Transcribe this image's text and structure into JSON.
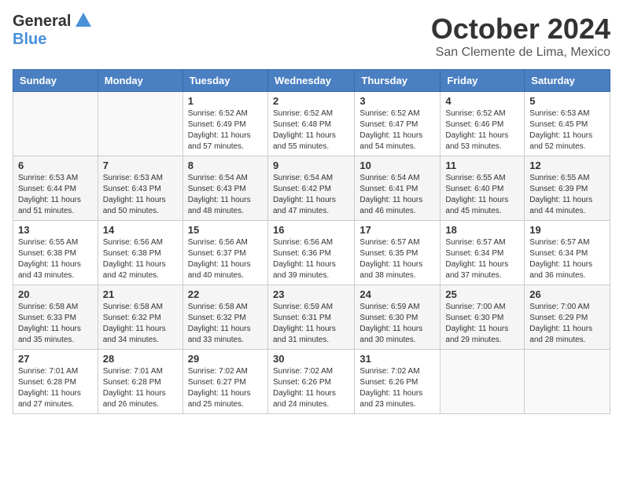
{
  "header": {
    "logo": {
      "general": "General",
      "blue": "Blue"
    },
    "month": "October 2024",
    "location": "San Clemente de Lima, Mexico"
  },
  "columns": [
    "Sunday",
    "Monday",
    "Tuesday",
    "Wednesday",
    "Thursday",
    "Friday",
    "Saturday"
  ],
  "weeks": [
    [
      {
        "day": "",
        "sunrise": "",
        "sunset": "",
        "daylight": ""
      },
      {
        "day": "",
        "sunrise": "",
        "sunset": "",
        "daylight": ""
      },
      {
        "day": "1",
        "sunrise": "Sunrise: 6:52 AM",
        "sunset": "Sunset: 6:49 PM",
        "daylight": "Daylight: 11 hours and 57 minutes."
      },
      {
        "day": "2",
        "sunrise": "Sunrise: 6:52 AM",
        "sunset": "Sunset: 6:48 PM",
        "daylight": "Daylight: 11 hours and 55 minutes."
      },
      {
        "day": "3",
        "sunrise": "Sunrise: 6:52 AM",
        "sunset": "Sunset: 6:47 PM",
        "daylight": "Daylight: 11 hours and 54 minutes."
      },
      {
        "day": "4",
        "sunrise": "Sunrise: 6:52 AM",
        "sunset": "Sunset: 6:46 PM",
        "daylight": "Daylight: 11 hours and 53 minutes."
      },
      {
        "day": "5",
        "sunrise": "Sunrise: 6:53 AM",
        "sunset": "Sunset: 6:45 PM",
        "daylight": "Daylight: 11 hours and 52 minutes."
      }
    ],
    [
      {
        "day": "6",
        "sunrise": "Sunrise: 6:53 AM",
        "sunset": "Sunset: 6:44 PM",
        "daylight": "Daylight: 11 hours and 51 minutes."
      },
      {
        "day": "7",
        "sunrise": "Sunrise: 6:53 AM",
        "sunset": "Sunset: 6:43 PM",
        "daylight": "Daylight: 11 hours and 50 minutes."
      },
      {
        "day": "8",
        "sunrise": "Sunrise: 6:54 AM",
        "sunset": "Sunset: 6:43 PM",
        "daylight": "Daylight: 11 hours and 48 minutes."
      },
      {
        "day": "9",
        "sunrise": "Sunrise: 6:54 AM",
        "sunset": "Sunset: 6:42 PM",
        "daylight": "Daylight: 11 hours and 47 minutes."
      },
      {
        "day": "10",
        "sunrise": "Sunrise: 6:54 AM",
        "sunset": "Sunset: 6:41 PM",
        "daylight": "Daylight: 11 hours and 46 minutes."
      },
      {
        "day": "11",
        "sunrise": "Sunrise: 6:55 AM",
        "sunset": "Sunset: 6:40 PM",
        "daylight": "Daylight: 11 hours and 45 minutes."
      },
      {
        "day": "12",
        "sunrise": "Sunrise: 6:55 AM",
        "sunset": "Sunset: 6:39 PM",
        "daylight": "Daylight: 11 hours and 44 minutes."
      }
    ],
    [
      {
        "day": "13",
        "sunrise": "Sunrise: 6:55 AM",
        "sunset": "Sunset: 6:38 PM",
        "daylight": "Daylight: 11 hours and 43 minutes."
      },
      {
        "day": "14",
        "sunrise": "Sunrise: 6:56 AM",
        "sunset": "Sunset: 6:38 PM",
        "daylight": "Daylight: 11 hours and 42 minutes."
      },
      {
        "day": "15",
        "sunrise": "Sunrise: 6:56 AM",
        "sunset": "Sunset: 6:37 PM",
        "daylight": "Daylight: 11 hours and 40 minutes."
      },
      {
        "day": "16",
        "sunrise": "Sunrise: 6:56 AM",
        "sunset": "Sunset: 6:36 PM",
        "daylight": "Daylight: 11 hours and 39 minutes."
      },
      {
        "day": "17",
        "sunrise": "Sunrise: 6:57 AM",
        "sunset": "Sunset: 6:35 PM",
        "daylight": "Daylight: 11 hours and 38 minutes."
      },
      {
        "day": "18",
        "sunrise": "Sunrise: 6:57 AM",
        "sunset": "Sunset: 6:34 PM",
        "daylight": "Daylight: 11 hours and 37 minutes."
      },
      {
        "day": "19",
        "sunrise": "Sunrise: 6:57 AM",
        "sunset": "Sunset: 6:34 PM",
        "daylight": "Daylight: 11 hours and 36 minutes."
      }
    ],
    [
      {
        "day": "20",
        "sunrise": "Sunrise: 6:58 AM",
        "sunset": "Sunset: 6:33 PM",
        "daylight": "Daylight: 11 hours and 35 minutes."
      },
      {
        "day": "21",
        "sunrise": "Sunrise: 6:58 AM",
        "sunset": "Sunset: 6:32 PM",
        "daylight": "Daylight: 11 hours and 34 minutes."
      },
      {
        "day": "22",
        "sunrise": "Sunrise: 6:58 AM",
        "sunset": "Sunset: 6:32 PM",
        "daylight": "Daylight: 11 hours and 33 minutes."
      },
      {
        "day": "23",
        "sunrise": "Sunrise: 6:59 AM",
        "sunset": "Sunset: 6:31 PM",
        "daylight": "Daylight: 11 hours and 31 minutes."
      },
      {
        "day": "24",
        "sunrise": "Sunrise: 6:59 AM",
        "sunset": "Sunset: 6:30 PM",
        "daylight": "Daylight: 11 hours and 30 minutes."
      },
      {
        "day": "25",
        "sunrise": "Sunrise: 7:00 AM",
        "sunset": "Sunset: 6:30 PM",
        "daylight": "Daylight: 11 hours and 29 minutes."
      },
      {
        "day": "26",
        "sunrise": "Sunrise: 7:00 AM",
        "sunset": "Sunset: 6:29 PM",
        "daylight": "Daylight: 11 hours and 28 minutes."
      }
    ],
    [
      {
        "day": "27",
        "sunrise": "Sunrise: 7:01 AM",
        "sunset": "Sunset: 6:28 PM",
        "daylight": "Daylight: 11 hours and 27 minutes."
      },
      {
        "day": "28",
        "sunrise": "Sunrise: 7:01 AM",
        "sunset": "Sunset: 6:28 PM",
        "daylight": "Daylight: 11 hours and 26 minutes."
      },
      {
        "day": "29",
        "sunrise": "Sunrise: 7:02 AM",
        "sunset": "Sunset: 6:27 PM",
        "daylight": "Daylight: 11 hours and 25 minutes."
      },
      {
        "day": "30",
        "sunrise": "Sunrise: 7:02 AM",
        "sunset": "Sunset: 6:26 PM",
        "daylight": "Daylight: 11 hours and 24 minutes."
      },
      {
        "day": "31",
        "sunrise": "Sunrise: 7:02 AM",
        "sunset": "Sunset: 6:26 PM",
        "daylight": "Daylight: 11 hours and 23 minutes."
      },
      {
        "day": "",
        "sunrise": "",
        "sunset": "",
        "daylight": ""
      },
      {
        "day": "",
        "sunrise": "",
        "sunset": "",
        "daylight": ""
      }
    ]
  ]
}
